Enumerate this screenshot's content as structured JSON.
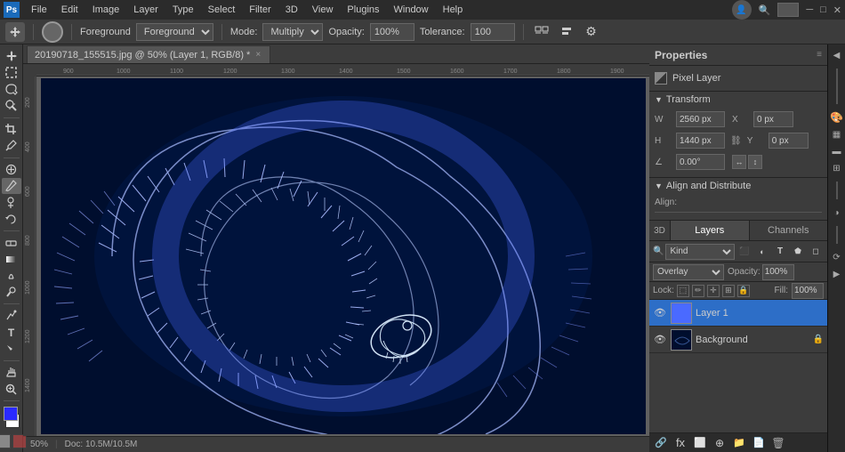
{
  "app": {
    "menu": [
      "File",
      "Edit",
      "Image",
      "Layer",
      "Type",
      "Select",
      "Filter",
      "3D",
      "View",
      "Plugins",
      "Window",
      "Help"
    ],
    "app_icon": "Ps"
  },
  "options_bar": {
    "mode_label": "Mode:",
    "mode_value": "Multiply",
    "opacity_label": "Opacity:",
    "opacity_value": "100%",
    "tolerance_label": "Tolerance:",
    "tolerance_value": "100"
  },
  "tab": {
    "title": "20190718_155515.jpg @ 50% (Layer 1, RGB/8) *",
    "close": "×"
  },
  "properties": {
    "panel_title": "Properties",
    "pixel_layer_label": "Pixel Layer",
    "transform_label": "Transform",
    "w_label": "W",
    "w_value": "2560 px",
    "h_label": "H",
    "h_value": "1440 px",
    "x_label": "X",
    "x_value": "0 px",
    "y_label": "Y",
    "y_value": "0 px",
    "angle_label": "∠",
    "angle_value": "0.00°",
    "align_distribute_label": "Align and Distribute",
    "align_label": "Align:"
  },
  "layers": {
    "panel_title": "Layers",
    "channels_label": "Channels",
    "search_placeholder": "Kind",
    "blend_mode": "Overlay",
    "opacity_label": "Opacity:",
    "opacity_value": "100%",
    "lock_label": "Lock:",
    "fill_label": "Fill:",
    "fill_value": "100%",
    "layer1_name": "Layer 1",
    "layer2_name": "Background",
    "3d_label": "3D"
  },
  "status_bar": {
    "zoom": "50%",
    "doc_size": "Doc: 10.5M/10.5M"
  },
  "tools": [
    "move",
    "rectangle-select",
    "lasso",
    "magic-wand",
    "crop",
    "eyedropper",
    "spot-heal",
    "brush",
    "clone-stamp",
    "history-brush",
    "eraser",
    "gradient",
    "blur",
    "dodge",
    "pen",
    "type",
    "path-selection",
    "shape",
    "hand",
    "zoom"
  ]
}
